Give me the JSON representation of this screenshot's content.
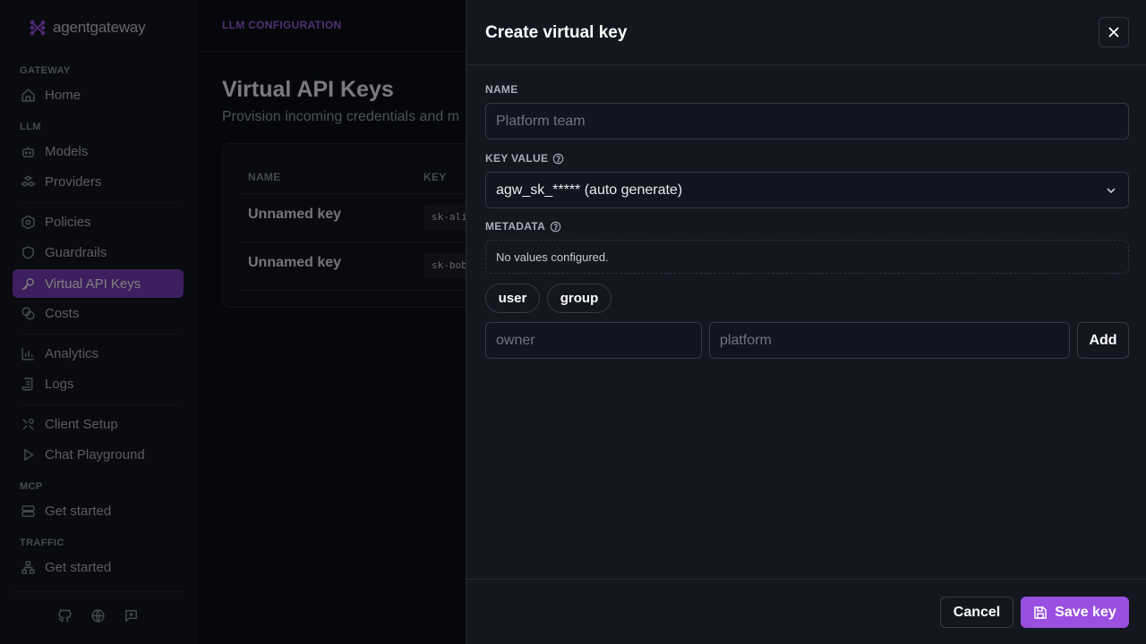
{
  "brand": {
    "name": "agentgateway",
    "accent": "#9a4fe0"
  },
  "sidebar": {
    "sections": {
      "gateway": "GATEWAY",
      "llm": "LLM",
      "mcp": "MCP",
      "traffic": "TRAFFIC"
    },
    "items": [
      {
        "label": "Home",
        "icon": "home-icon"
      },
      {
        "label": "Models",
        "icon": "robot-icon"
      },
      {
        "label": "Providers",
        "icon": "cubes-icon"
      },
      {
        "label": "Policies",
        "icon": "hexagon-icon"
      },
      {
        "label": "Guardrails",
        "icon": "shield-icon"
      },
      {
        "label": "Virtual API Keys",
        "icon": "key-icon",
        "active": true
      },
      {
        "label": "Costs",
        "icon": "coins-icon"
      },
      {
        "label": "Analytics",
        "icon": "bar-chart-icon"
      },
      {
        "label": "Logs",
        "icon": "scroll-icon"
      },
      {
        "label": "Client Setup",
        "icon": "tools-icon"
      },
      {
        "label": "Chat Playground",
        "icon": "play-icon"
      },
      {
        "label": "Get started",
        "icon": "server-icon"
      },
      {
        "label": "Get started",
        "icon": "network-icon"
      }
    ],
    "footer_icons": [
      "github-icon",
      "globe-icon",
      "feedback-icon"
    ]
  },
  "main": {
    "breadcrumb": "LLM CONFIGURATION",
    "title": "Virtual API Keys",
    "subtitle": "Provision incoming credentials and m",
    "table": {
      "columns": [
        "NAME",
        "KEY"
      ],
      "rows": [
        {
          "name": "Unnamed key",
          "key": "sk-ali"
        },
        {
          "name": "Unnamed key",
          "key": "sk-bob"
        }
      ]
    }
  },
  "drawer": {
    "title": "Create virtual key",
    "name_label": "NAME",
    "name_placeholder": "Platform team",
    "key_label": "KEY VALUE",
    "key_value": "agw_sk_***** (auto generate)",
    "metadata_label": "METADATA",
    "metadata_empty": "No values configured.",
    "chips": [
      "user",
      "group"
    ],
    "meta_key_placeholder": "owner",
    "meta_value_placeholder": "platform",
    "add_label": "Add",
    "cancel_label": "Cancel",
    "save_label": "Save key"
  }
}
